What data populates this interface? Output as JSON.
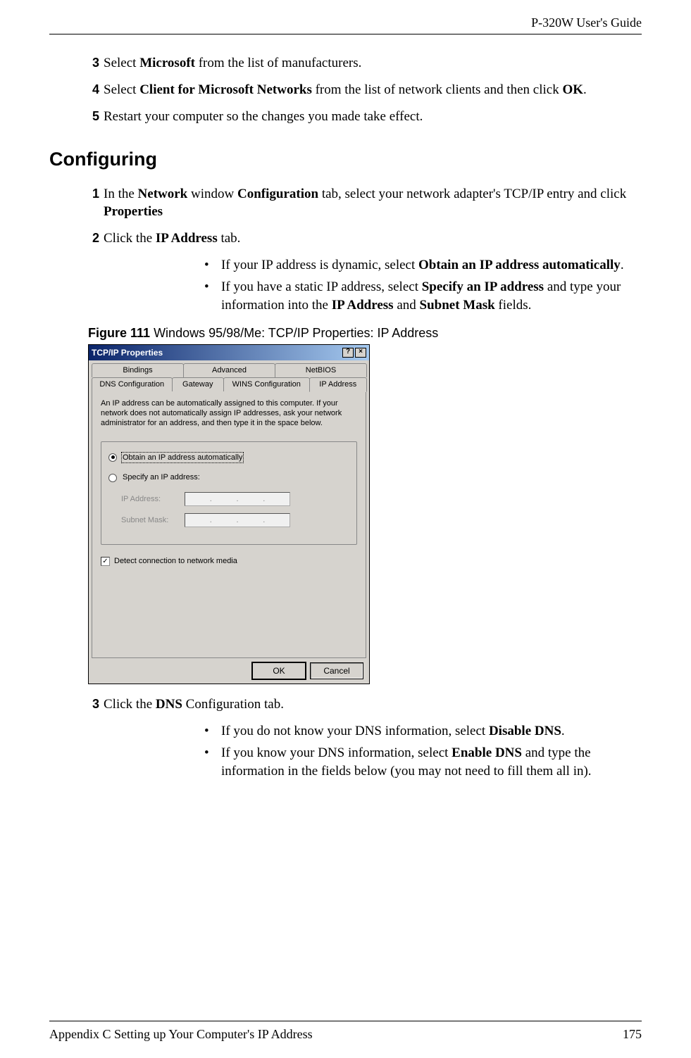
{
  "header": {
    "doc_title": "P-320W User's Guide"
  },
  "initial_steps": [
    {
      "num": "3",
      "parts": [
        "Select ",
        "Microsoft",
        " from the list of manufacturers."
      ]
    },
    {
      "num": "4",
      "parts": [
        "Select ",
        "Client for Microsoft Networks",
        " from the list of network clients and then click ",
        "OK",
        "."
      ]
    },
    {
      "num": "5",
      "parts": [
        "Restart your computer so the changes you made take effect."
      ]
    }
  ],
  "section_heading": "Configuring",
  "config_steps_a": [
    {
      "num": "1",
      "parts": [
        "In the ",
        "Network",
        " window ",
        "Configuration",
        " tab, select your network adapter's TCP/IP entry and click ",
        "Properties"
      ]
    },
    {
      "num": "2",
      "parts": [
        "Click the ",
        "IP Address",
        " tab."
      ]
    }
  ],
  "bullets_a": [
    [
      "If your IP address is dynamic, select ",
      "Obtain an IP address automatically",
      "."
    ],
    [
      "If you have a static IP address, select ",
      "Specify an IP address",
      " and type your information into the ",
      "IP Address",
      " and ",
      "Subnet Mask",
      " fields."
    ]
  ],
  "figure": {
    "label": "Figure 111",
    "caption": "   Windows 95/98/Me: TCP/IP Properties: IP Address"
  },
  "dialog": {
    "title": "TCP/IP Properties",
    "help_btn": "?",
    "close_btn": "×",
    "tabs_back": [
      "Bindings",
      "Advanced",
      "NetBIOS"
    ],
    "tabs_front": [
      "DNS Configuration",
      "Gateway",
      "WINS Configuration",
      "IP Address"
    ],
    "active_tab": "IP Address",
    "description": "An IP address can be automatically assigned to this computer. If your network does not automatically assign IP addresses, ask your network administrator for an address, and then type it in the space below.",
    "radio_auto": "Obtain an IP address automatically",
    "radio_specify": "Specify an IP address:",
    "ip_label": "IP Address:",
    "subnet_label": "Subnet Mask:",
    "ip_dots": ".",
    "detect_label": "Detect connection to network media",
    "ok": "OK",
    "cancel": "Cancel"
  },
  "config_steps_b": [
    {
      "num": "3",
      "parts": [
        "Click the ",
        "DNS",
        " Configuration tab."
      ]
    }
  ],
  "bullets_b": [
    [
      "If you do not know your DNS information, select ",
      "Disable DNS",
      "."
    ],
    [
      "If you know your DNS information, select ",
      "Enable DNS",
      " and type the information in the fields below (you may not need to fill them all in)."
    ]
  ],
  "footer": {
    "appendix": "Appendix C Setting up Your Computer's IP Address",
    "page": "175"
  }
}
